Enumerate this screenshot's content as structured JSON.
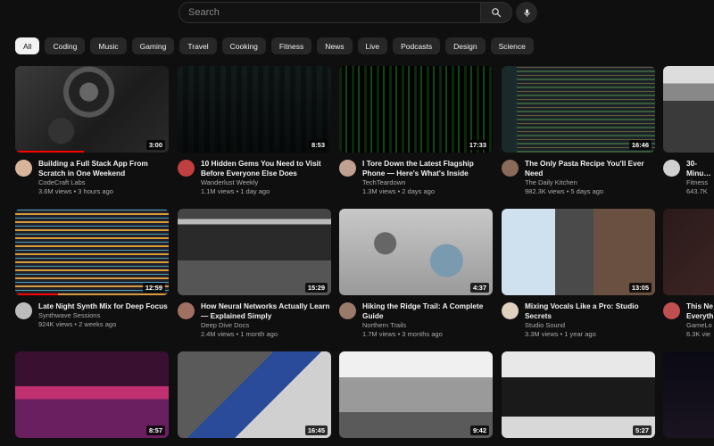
{
  "search": {
    "placeholder": "Search",
    "search_icon": "search-icon",
    "mic_icon": "mic-icon"
  },
  "chips": [
    {
      "label": "All",
      "active": true
    },
    {
      "label": "Coding"
    },
    {
      "label": "Music"
    },
    {
      "label": "Gaming"
    },
    {
      "label": "Travel"
    },
    {
      "label": "Cooking"
    },
    {
      "label": "Fitness"
    },
    {
      "label": "News"
    },
    {
      "label": "Live"
    },
    {
      "label": "Podcasts"
    },
    {
      "label": "Design"
    },
    {
      "label": "Science"
    }
  ],
  "videos": [
    {
      "title": "Building a Full Stack App From Scratch in One Weekend",
      "channel": "CodeCraft Labs",
      "stats": "3.6M views • 3 hours ago",
      "duration": "3:00",
      "progress": 0.45
    },
    {
      "title": "10 Hidden Gems You Need to Visit Before Everyone Else Does",
      "channel": "Wanderlust Weekly",
      "stats": "1.1M views • 1 day ago",
      "duration": "8:53"
    },
    {
      "title": "I Tore Down the Latest Flagship Phone — Here's What's Inside",
      "channel": "TechTeardown",
      "stats": "1.3M views • 2 days ago",
      "duration": "17:33"
    },
    {
      "title": "The Only Pasta Recipe You'll Ever Need",
      "channel": "The Daily Kitchen",
      "stats": "982.3K views • 5 days ago",
      "duration": "16:46"
    },
    {
      "title": "30-Minu Equipme",
      "channel": "Fitness",
      "stats": "643.7K",
      "duration": ""
    },
    {
      "title": "Late Night Synth Mix for Deep Focus",
      "channel": "Synthwave Sessions",
      "stats": "924K views • 2 weeks ago",
      "duration": "12:59",
      "progress": 0.28
    },
    {
      "title": "How Neural Networks Actually Learn — Explained Simply",
      "channel": "Deep Dive Docs",
      "stats": "2.4M views • 1 month ago",
      "duration": "15:29"
    },
    {
      "title": "Hiking the Ridge Trail: A Complete Guide",
      "channel": "Northern Trails",
      "stats": "1.7M views • 3 months ago",
      "duration": "4:37"
    },
    {
      "title": "Mixing Vocals Like a Pro: Studio Secrets",
      "channel": "Studio Sound",
      "stats": "3.3M views • 1 year ago",
      "duration": "13:05"
    },
    {
      "title": "This Ne Everythi",
      "channel": "GameLo",
      "stats": "6.3K vie",
      "duration": ""
    },
    {
      "title": "",
      "channel": "",
      "stats": "",
      "duration": "8:57"
    },
    {
      "title": "",
      "channel": "",
      "stats": "",
      "duration": "16:45"
    },
    {
      "title": "",
      "channel": "",
      "stats": "",
      "duration": "9:42"
    },
    {
      "title": "",
      "channel": "",
      "stats": "",
      "duration": "5:27"
    },
    {
      "title": "",
      "channel": "",
      "stats": "",
      "duration": ""
    }
  ]
}
